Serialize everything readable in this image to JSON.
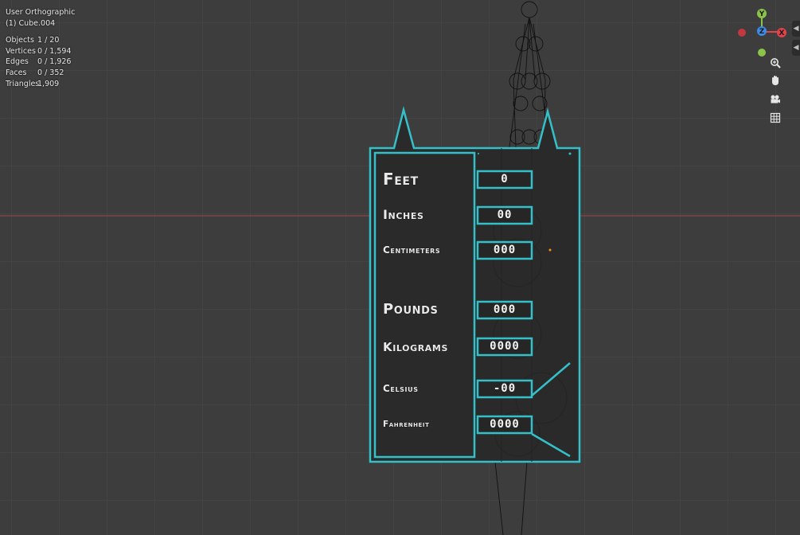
{
  "viewport": {
    "view_name": "User Orthographic",
    "active_object": "(1) Cube.004",
    "stats": [
      {
        "label": "Objects",
        "value": "1 / 20"
      },
      {
        "label": "Vertices",
        "value": "0 / 1,594"
      },
      {
        "label": "Edges",
        "value": "0 / 1,926"
      },
      {
        "label": "Faces",
        "value": "0 / 352"
      },
      {
        "label": "Triangles",
        "value": "1,909"
      }
    ]
  },
  "gizmo": {
    "y_label": "Y",
    "x_label": "X",
    "z_label": "Z",
    "colors": {
      "x": "#e2434b",
      "y": "#8bc34a",
      "z": "#3d8be8"
    }
  },
  "navigation": {
    "icons": [
      "zoom-icon",
      "pan-hand-icon",
      "camera-icon",
      "grid-icon"
    ]
  },
  "panel": {
    "accent_color": "#35c0c9",
    "rows": [
      {
        "label": "Feet",
        "value": "0"
      },
      {
        "label": "Inches",
        "value": "00"
      },
      {
        "label": "Centimeters",
        "value": "000"
      },
      {
        "label": "Pounds",
        "value": "000"
      },
      {
        "label": "Kilograms",
        "value": "0000"
      },
      {
        "label": "Celsius",
        "value": "-00"
      },
      {
        "label": "Fahrenheit",
        "value": "0000"
      }
    ]
  }
}
